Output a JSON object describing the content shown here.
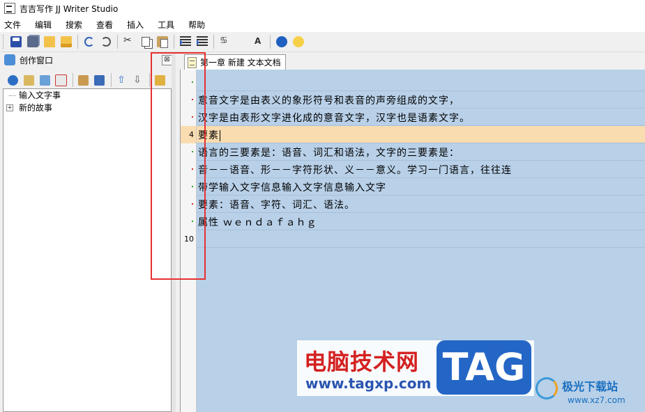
{
  "window": {
    "title": "吉吉写作 JJ Writer Studio"
  },
  "menu": [
    "文件",
    "编辑",
    "搜索",
    "查看",
    "插入",
    "工具",
    "帮助"
  ],
  "left_panel": {
    "title": "创作窗口",
    "close_glyph": "⊠",
    "tree": [
      {
        "label": "输入文字事",
        "expandable": false
      },
      {
        "label": "新的故事",
        "expandable": true,
        "expand_glyph": "+"
      }
    ]
  },
  "tab": {
    "label": "第一章 新建 文本文档"
  },
  "editor": {
    "lines": [
      {
        "number": "",
        "text": ""
      },
      {
        "number": "",
        "text": "意音文字是由表义的象形符号和表音的声旁组成的文字，"
      },
      {
        "number": "",
        "text": "汉字是由表形文字进化成的意音文字，汉字也是语素文字。"
      },
      {
        "number": "4",
        "text": "要素",
        "current": true
      },
      {
        "number": "",
        "text": "语言的三要素是：语音、词汇和语法，文字的三要素是："
      },
      {
        "number": "",
        "text": "音－－语音、形－－字符形状、义－－意义。学习一门语言，往往连"
      },
      {
        "number": "",
        "text": "带学输入文字信息输入文字信息输入文字"
      },
      {
        "number": "",
        "text": "要素：语音、字符、词汇、语法。"
      },
      {
        "number": "",
        "text": "属性 ｗｅｎｄａｆａｈｇ"
      },
      {
        "number": "10",
        "text": ""
      }
    ],
    "dot_colors": [
      "#22aa22",
      "#dd2222",
      "#dd2222",
      "",
      "#22aa22",
      "#dd2222",
      "#22aa22",
      "#dd2222",
      "#22aa22",
      ""
    ]
  },
  "watermark": {
    "title": "电脑技术网",
    "url": "www.tagxp.com",
    "tag": "TAG",
    "site2_title": "极光下载站",
    "site2_url": "www.xz7.com"
  },
  "colors": {
    "annotation_box": "#e83030",
    "current_line": "#f9dcb0",
    "editor_bg": "#b8d0e8"
  }
}
